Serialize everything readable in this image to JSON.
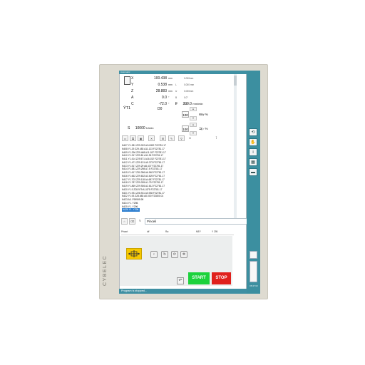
{
  "brand": "CYBELEC",
  "window": {
    "title": "Automatic"
  },
  "axes": [
    {
      "name": "X",
      "value": "100.438",
      "unit": "mm",
      "sub_label": "",
      "sub_value": "0.000mm"
    },
    {
      "name": "Y",
      "value": "0.538",
      "unit": "mm",
      "sub_label": "L",
      "sub_value": "0.000 mm"
    },
    {
      "name": "Z",
      "value": "28.883",
      "unit": "mm",
      "sub_label": "U",
      "sub_value": "0.000mm"
    },
    {
      "name": "A",
      "value": "0.0",
      "unit": "°",
      "sub_label": "B",
      "sub_value": "0.0°"
    },
    {
      "name": "C",
      "value": "-72.0",
      "unit": "°",
      "sub_label": "C",
      "sub_value": "0.0°"
    }
  ],
  "feed": {
    "label": "F",
    "value": "200.0",
    "unit": "mm/min",
    "override": "100",
    "override_unit": "%"
  },
  "tool": {
    "label": "T1",
    "value": "D0"
  },
  "spindle": {
    "label": "S",
    "value": "10000",
    "unit": "U/min",
    "override": "100",
    "override_unit": "%"
  },
  "program_lines": [
    "N407 Y1.381 Z29.022 A24.892 F22781.17",
    "N408 Y1.29 Z29.483 A11.123 F22781.17",
    "N409 Y1.296 Z29.468 A11.187 F22781.17",
    "N410 Y1.317 Z29.81 A11.35 F22781.17",
    "N411 Y1.414 Z29.571 A16.152 F22781.17",
    "N412 Y1.471 Z29.131 A5.373 F22781.17",
    "N413 Y1.517 Z29.29 A6.437 F22781.17",
    "N414 Y1.581 Z29.298 A7.5 F22781.17",
    "N415 Y1.617 Z30.396 A6.562 F22781.17",
    "N416 Y1.662 Z29.632 A3.625 F22781.17",
    "N417 Y1.703 Z29.118 A4.687 F22781.17",
    "N418 Y1.787 Z29.035 A1.75 F22781.17",
    "N419 Y1.869 Z29.926 A2.812 F22781.17",
    "N420 Y1.9 Z28.979 A1.875 F22781.17",
    "N421 Y1.931 Z28.911 A0.938 F22781.17",
    "N422 Y1.93 Z28.883 A0.000 F22800.01",
    "N423 A0. F99999.99",
    "N424 Y1. Y298.",
    "N425 Y1. Y296.",
    "N426 Y1. Y296."
  ],
  "command": {
    "value": "Pinceli"
  },
  "info_headers": [
    "Pécart",
    "dif",
    "Ra:",
    "MEY",
    "Y 295"
  ],
  "buttons": {
    "start": "START",
    "stop": "STOP"
  },
  "status": {
    "message": "Program is stopped..."
  },
  "clock": "08:47:02"
}
